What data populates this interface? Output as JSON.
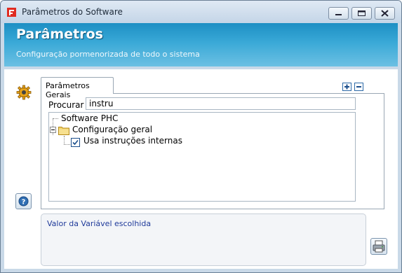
{
  "window": {
    "title": "Parâmetros do Software",
    "controls": [
      "minimize-icon",
      "maximize-icon",
      "close-icon"
    ]
  },
  "header": {
    "title": "Parâmetros",
    "subtitle": "Configuração pormenorizada de todo o sistema"
  },
  "tabs": [
    {
      "label": "Parâmetros Gerais",
      "active": true
    }
  ],
  "search": {
    "label": "Procurar :",
    "value": "instru"
  },
  "tree": {
    "root": "Software PHC",
    "group": "Configuração geral",
    "item": {
      "label": "Usa instruções internas",
      "checked": true
    }
  },
  "value_panel": {
    "label": "Valor da Variável escolhida"
  },
  "icons": {
    "app": "phc-logo-icon",
    "settings": "gear-icon",
    "help": "help-icon",
    "expand_all": "plus-icon",
    "collapse_all": "minus-icon",
    "print": "printer-icon",
    "folder": "folder-icon"
  },
  "colors": {
    "header_top": "#1d8fc4",
    "header_bottom": "#6cc0e3",
    "value_label": "#1f3a9a",
    "window_frame": "#c9d9e8"
  }
}
